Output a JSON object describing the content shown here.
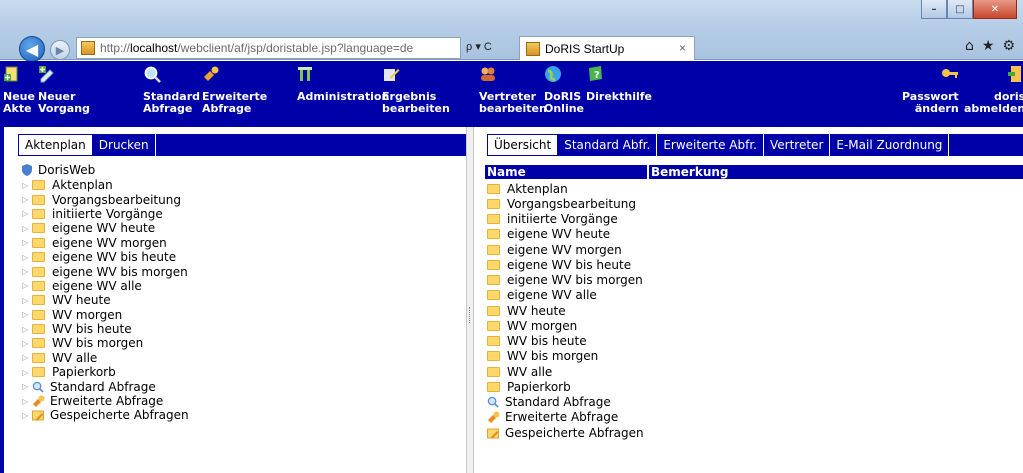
{
  "browser": {
    "url_prefix": "http://",
    "url_host": "localhost",
    "url_path": "/webclient/af/jsp/doristable.jsp?language=de",
    "address_tools": "ρ ▾ C",
    "tab_title": "DoRIS StartUp",
    "tab_close": "×"
  },
  "toolbar": {
    "items": [
      {
        "line1": "Neue",
        "line2": "Akte",
        "icon": "new-file-icon"
      },
      {
        "line1": "Neuer",
        "line2": "Vorgang",
        "icon": "new-process-icon"
      },
      {
        "line1": "Standard",
        "line2": "Abfrage",
        "icon": "search-icon"
      },
      {
        "line1": "Erweiterte",
        "line2": "Abfrage",
        "icon": "wrench-icon"
      },
      {
        "line1": "Administration",
        "line2": "",
        "icon": "tools-icon"
      },
      {
        "line1": "Ergebnis",
        "line2": "bearbeiten",
        "icon": "edit-icon"
      },
      {
        "line1": "Vertreter",
        "line2": "bearbeiten",
        "icon": "users-icon"
      },
      {
        "line1": "DoRIS",
        "line2": "Online",
        "icon": "globe-icon"
      },
      {
        "line1": "Direkthilfe",
        "line2": "",
        "icon": "help-icon"
      },
      {
        "line1": "Passwort",
        "line2": "ändern",
        "icon": "key-icon"
      },
      {
        "line1": "doris",
        "line2": "abmelden",
        "icon": "logout-icon"
      }
    ]
  },
  "left_pane": {
    "tabs": [
      "Aktenplan",
      "Drucken"
    ],
    "root": "DorisWeb",
    "tree": [
      {
        "label": "Aktenplan",
        "icon": "folder-icon"
      },
      {
        "label": "Vorgangsbearbeitung",
        "icon": "folder-icon"
      },
      {
        "label": "initiierte Vorgänge",
        "icon": "folder-icon"
      },
      {
        "label": "eigene WV heute",
        "icon": "folder-icon"
      },
      {
        "label": "eigene WV morgen",
        "icon": "folder-icon"
      },
      {
        "label": "eigene WV bis heute",
        "icon": "folder-icon"
      },
      {
        "label": "eigene WV bis morgen",
        "icon": "folder-icon"
      },
      {
        "label": "eigene WV alle",
        "icon": "folder-icon"
      },
      {
        "label": "WV heute",
        "icon": "folder-icon"
      },
      {
        "label": "WV morgen",
        "icon": "folder-icon"
      },
      {
        "label": "WV bis heute",
        "icon": "folder-icon"
      },
      {
        "label": "WV bis morgen",
        "icon": "folder-icon"
      },
      {
        "label": "WV alle",
        "icon": "folder-icon"
      },
      {
        "label": "Papierkorb",
        "icon": "folder-icon"
      },
      {
        "label": "Standard Abfrage",
        "icon": "search-icon"
      },
      {
        "label": "Erweiterte Abfrage",
        "icon": "wrench-icon"
      },
      {
        "label": "Gespeicherte Abfragen",
        "icon": "saved-query-icon"
      }
    ]
  },
  "right_pane": {
    "tabs": [
      "Übersicht",
      "Standard Abfr.",
      "Erweiterte Abfr.",
      "Vertreter",
      "E-Mail Zuordnung"
    ],
    "columns": [
      "Name",
      "Bemerkung"
    ],
    "rows": [
      {
        "label": "Aktenplan",
        "icon": "folder-icon"
      },
      {
        "label": "Vorgangsbearbeitung",
        "icon": "folder-icon"
      },
      {
        "label": "initiierte Vorgänge",
        "icon": "folder-icon"
      },
      {
        "label": "eigene WV heute",
        "icon": "folder-icon"
      },
      {
        "label": "eigene WV morgen",
        "icon": "folder-icon"
      },
      {
        "label": "eigene WV bis heute",
        "icon": "folder-icon"
      },
      {
        "label": "eigene WV bis morgen",
        "icon": "folder-icon"
      },
      {
        "label": "eigene WV alle",
        "icon": "folder-icon"
      },
      {
        "label": "WV heute",
        "icon": "folder-icon"
      },
      {
        "label": "WV morgen",
        "icon": "folder-icon"
      },
      {
        "label": "WV bis heute",
        "icon": "folder-icon"
      },
      {
        "label": "WV bis morgen",
        "icon": "folder-icon"
      },
      {
        "label": "WV alle",
        "icon": "folder-icon"
      },
      {
        "label": "Papierkorb",
        "icon": "folder-icon"
      },
      {
        "label": "Standard Abfrage",
        "icon": "search-icon"
      },
      {
        "label": "Erweiterte Abfrage",
        "icon": "wrench-icon"
      },
      {
        "label": "Gespeicherte Abfragen",
        "icon": "saved-query-icon"
      }
    ]
  },
  "colors": {
    "brand_blue": "#0000a8",
    "folder": "#ffd86b"
  }
}
